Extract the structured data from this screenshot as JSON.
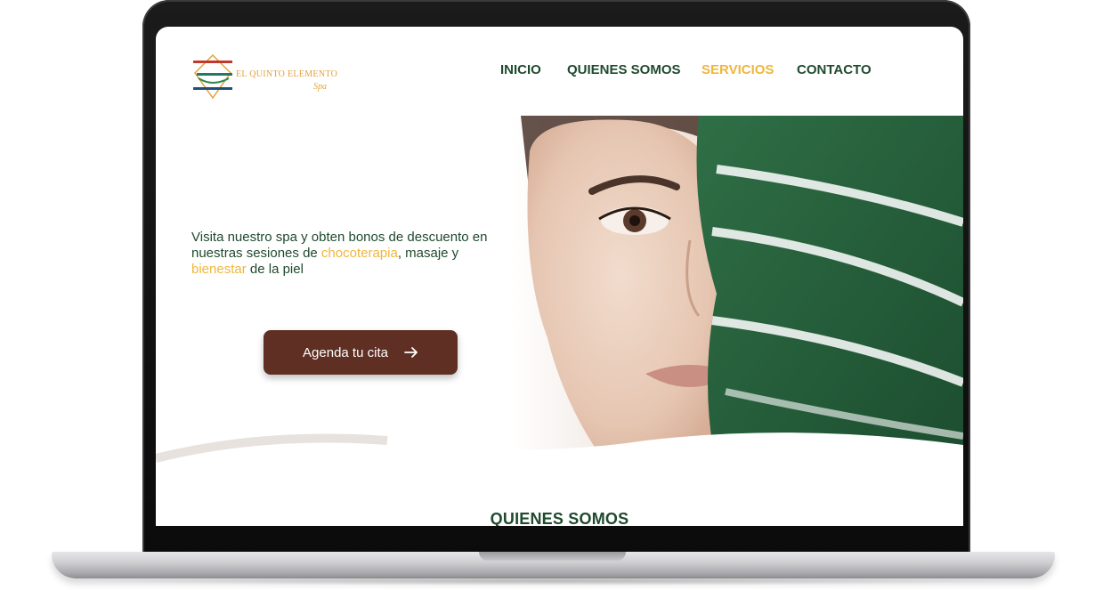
{
  "brand": {
    "name": "EL QUINTO ELEMENTO",
    "sub": "Spa",
    "logo_icon": "diamond-logo-icon"
  },
  "nav": {
    "items": [
      {
        "label": "INICIO",
        "active": false
      },
      {
        "label": "QUIENES SOMOS",
        "active": false
      },
      {
        "label": "SERVICIOS",
        "active": true
      },
      {
        "label": "CONTACTO",
        "active": false
      }
    ]
  },
  "hero": {
    "text_1": "Visita nuestro spa y obten bonos de descuento en nuestras sesiones de ",
    "highlight_1": "chocoterapia",
    "text_2": ", masaje y ",
    "highlight_2": "bienestar",
    "text_3": " de la piel",
    "cta_label": "Agenda tu cita",
    "cta_icon": "arrow-right-icon"
  },
  "section": {
    "title": "QUIENES SOMOS"
  },
  "colors": {
    "primary_green": "#1f4a2e",
    "accent_gold": "#f0b63b",
    "button_brown": "#5f2f23"
  }
}
